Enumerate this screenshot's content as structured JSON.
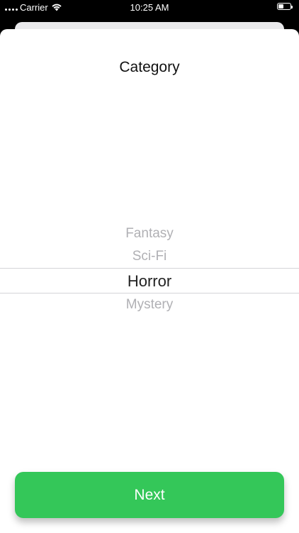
{
  "status_bar": {
    "carrier": "Carrier",
    "time": "10:25 AM",
    "battery_level": 0.45
  },
  "sheet": {
    "title": "Category"
  },
  "picker": {
    "options": [
      "Fantasy",
      "Sci-Fi",
      "Horror",
      "Mystery"
    ],
    "selected_index": 2
  },
  "next_button": {
    "label": "Next"
  },
  "colors": {
    "accent": "#34c759",
    "background": "#000000",
    "sheet": "#ffffff"
  }
}
